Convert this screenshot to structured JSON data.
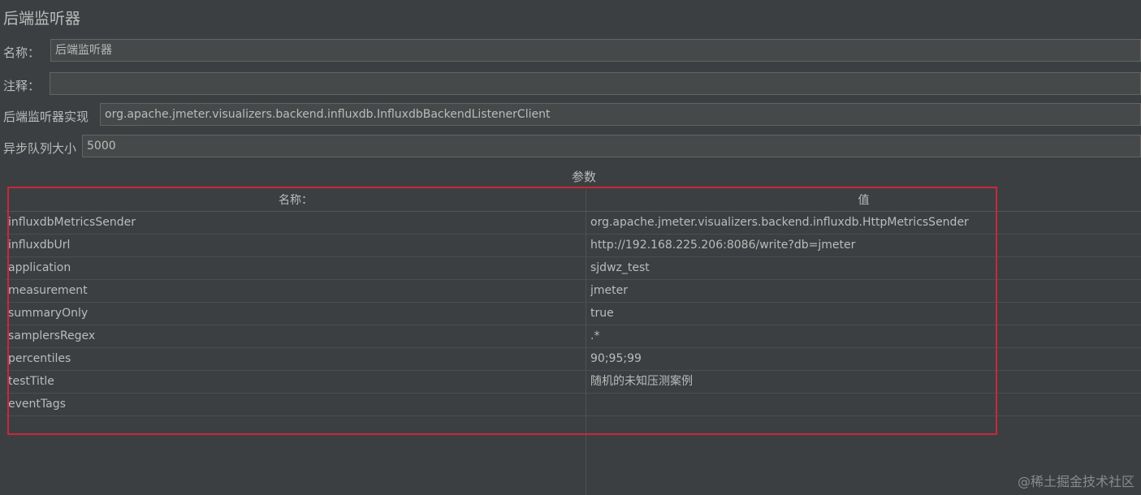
{
  "panel": {
    "title": "后端监听器"
  },
  "form": {
    "name_label": "名称：",
    "name_value": "后端监听器",
    "comment_label": "注释：",
    "comment_value": "",
    "impl_label": "后端监听器实现",
    "impl_value": "org.apache.jmeter.visualizers.backend.influxdb.InfluxdbBackendListenerClient",
    "queue_label": "异步队列大小",
    "queue_value": "5000"
  },
  "params": {
    "section_label": "参数",
    "columns": [
      "名称：",
      "值"
    ],
    "rows": [
      {
        "name": "influxdbMetricsSender",
        "value": "org.apache.jmeter.visualizers.backend.influxdb.HttpMetricsSender"
      },
      {
        "name": "influxdbUrl",
        "value": "http://192.168.225.206:8086/write?db=jmeter"
      },
      {
        "name": "application",
        "value": "sjdwz_test"
      },
      {
        "name": "measurement",
        "value": "jmeter"
      },
      {
        "name": "summaryOnly",
        "value": "true"
      },
      {
        "name": "samplersRegex",
        "value": ".*"
      },
      {
        "name": "percentiles",
        "value": "90;95;99"
      },
      {
        "name": "testTitle",
        "value": "随机的未知压测案例"
      },
      {
        "name": "eventTags",
        "value": ""
      }
    ]
  },
  "colors": {
    "background": "#3c3f41",
    "highlight": "#c8283a"
  },
  "watermark": "@稀土掘金技术社区"
}
